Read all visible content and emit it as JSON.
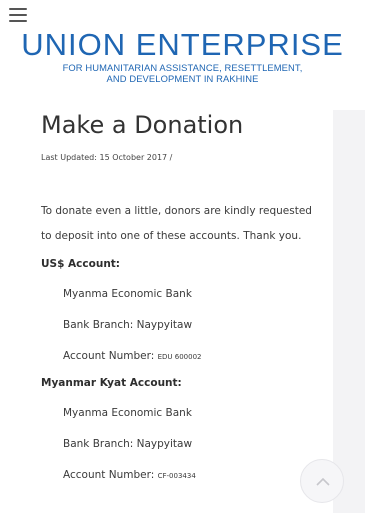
{
  "icons": {
    "menu": "hamburger-menu-icon",
    "scroll_top": "chevron-up-icon"
  },
  "colors": {
    "brand": "#1f66b3",
    "text": "#333333"
  },
  "header": {
    "logo_title": "UNION ENTERPRISE",
    "logo_subtitle_line1": "FOR HUMANITARIAN ASSISTANCE, RESETTLEMENT,",
    "logo_subtitle_line2": "AND DEVELOPMENT IN RAKHINE"
  },
  "article": {
    "title": "Make a Donation",
    "last_updated": "Last Updated: 15 October 2017 /",
    "intro_line1": "To donate even a little, donors are kindly requested",
    "intro_line2": "to deposit into one of these accounts. Thank you."
  },
  "usd_account": {
    "heading": "US$ Account:",
    "bank": "Myanma Economic Bank",
    "branch": "Bank Branch: Naypyitaw",
    "number_label": "Account Number: ",
    "number_value": "EDU 600002"
  },
  "kyat_account": {
    "heading": "Myanmar Kyat Account:",
    "bank": "Myanma Economic Bank",
    "branch": "Bank Branch: Naypyitaw",
    "number_label": "Account Number: ",
    "number_value": "CF-003434"
  }
}
